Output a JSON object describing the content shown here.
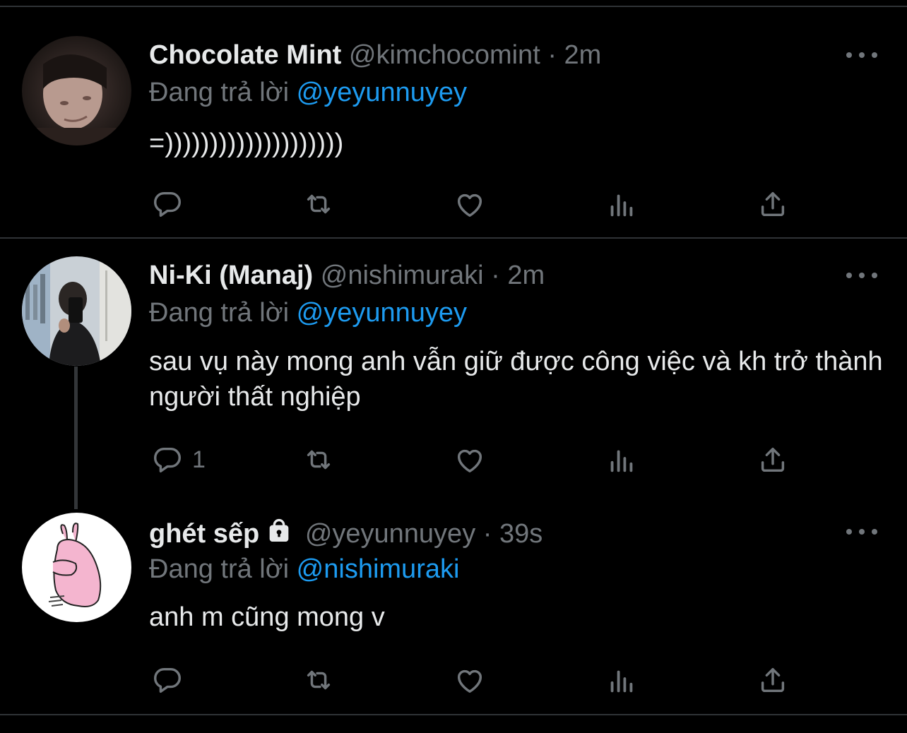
{
  "tweets": [
    {
      "display_name": "Chocolate Mint",
      "handle": "@kimchocomint",
      "separator": "·",
      "time": "2m",
      "reply_prefix": "Đang trả lời",
      "reply_to": "@yeyunnuyey",
      "text": "=))))))))))))))))))))",
      "reply_count": "",
      "avatar": "profile-photo",
      "locked": false
    },
    {
      "display_name": "Ni-Ki (Manaj)",
      "handle": "@nishimuraki",
      "separator": "·",
      "time": "2m",
      "reply_prefix": "Đang trả lời",
      "reply_to": "@yeyunnuyey",
      "text": "sau vụ này mong anh vẫn giữ được công việc và kh trở thành người thất nghiệp",
      "reply_count": "1",
      "avatar": "mirror-selfie-photo",
      "locked": false
    },
    {
      "display_name": "ghét sếp",
      "handle": "@yeyunnuyey",
      "separator": "·",
      "time": "39s",
      "reply_prefix": "Đang trả lời",
      "reply_to": "@nishimuraki",
      "text": "anh m cũng mong v",
      "reply_count": "",
      "avatar": "pink-bunny-sticker",
      "locked": true
    }
  ],
  "icons": [
    "reply-icon",
    "retweet-icon",
    "like-icon",
    "analytics-icon",
    "share-icon",
    "more-icon",
    "lock-icon"
  ],
  "colors": {
    "background": "#000000",
    "text_primary": "#e7e9ea",
    "text_secondary": "#71767b",
    "accent": "#1d9bf0",
    "divider": "#2f3336"
  }
}
